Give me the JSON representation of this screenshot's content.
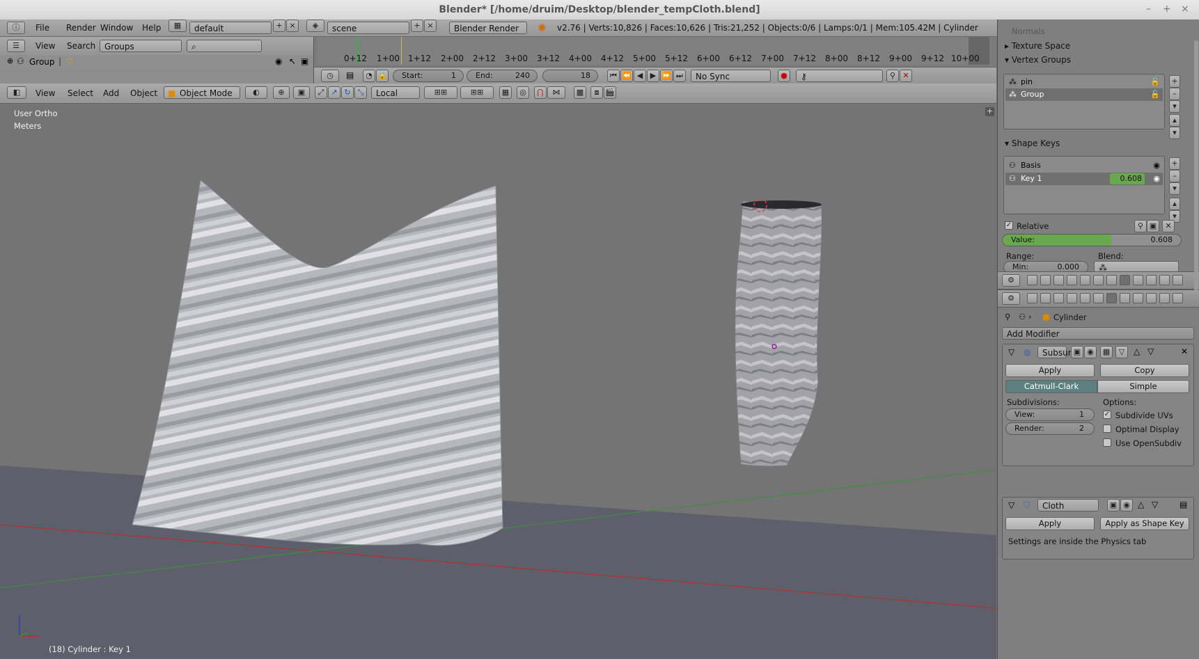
{
  "window": {
    "title": "Blender* [/home/druim/Desktop/blender_tempCloth.blend]",
    "minimize": "–",
    "maximize": "+",
    "close": "×"
  },
  "topbar": {
    "menus": [
      "File",
      "Render",
      "Window",
      "Help"
    ],
    "layout": "default",
    "scene": "scene",
    "engine": "Blender Render",
    "info": "v2.76 | Verts:10,826 | Faces:10,626 | Tris:21,252 | Objects:0/6 | Lamps:0/1 | Mem:105.42M | Cylinder"
  },
  "outliner": {
    "menus": [
      "View",
      "Search"
    ],
    "display_mode": "Groups",
    "item": "Group"
  },
  "timeline": {
    "ticks": [
      "0+12",
      "1+00",
      "1+12",
      "2+00",
      "2+12",
      "3+00",
      "3+12",
      "4+00",
      "4+12",
      "5+00",
      "5+12",
      "6+00",
      "6+12",
      "7+00",
      "7+12",
      "8+00",
      "8+12",
      "9+00",
      "9+12",
      "10+00"
    ],
    "start_label": "Start:",
    "start": "1",
    "end_label": "End:",
    "end": "240",
    "current": "18",
    "sync": "No Sync"
  },
  "view3d": {
    "menus": [
      "View",
      "Select",
      "Add",
      "Object"
    ],
    "mode": "Object Mode",
    "orientation": "Local",
    "view_label": "User Ortho",
    "units_label": "Meters",
    "status": "(18) Cylinder : Key 1"
  },
  "properties": {
    "partial_top": "Normals",
    "texture_space": "Texture Space",
    "vertex_groups": {
      "title": "Vertex Groups",
      "items": [
        "pin",
        "Group"
      ]
    },
    "shape_keys": {
      "title": "Shape Keys",
      "items": [
        "Basis",
        "Key 1"
      ],
      "key1_value": "0.608",
      "relative": "Relative",
      "value_label": "Value:",
      "value": "0.608",
      "value_fraction": 0.608,
      "range_label": "Range:",
      "blend_label": "Blend:",
      "min_label": "Min:",
      "min_value": "0.000"
    },
    "object_name": "Cylinder",
    "add_modifier": "Add Modifier",
    "subsurf": {
      "name": "Subsur",
      "apply": "Apply",
      "copy": "Copy",
      "catmull": "Catmull-Clark",
      "simple": "Simple",
      "subdivisions": "Subdivisions:",
      "options": "Options:",
      "view_label": "View:",
      "view_value": "1",
      "render_label": "Render:",
      "render_value": "2",
      "subdivide_uvs": "Subdivide UVs",
      "optimal_display": "Optimal Display",
      "use_opensubdiv": "Use OpenSubdiv"
    },
    "cloth": {
      "name": "Cloth",
      "apply": "Apply",
      "apply_shape": "Apply as Shape Key",
      "note": "Settings are inside the Physics tab"
    }
  }
}
